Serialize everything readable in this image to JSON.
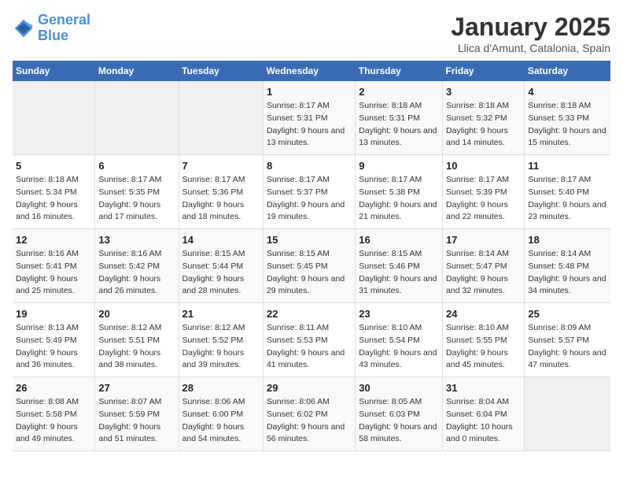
{
  "logo": {
    "line1": "General",
    "line2": "Blue"
  },
  "title": "January 2025",
  "subtitle": "Llica d'Amunt, Catalonia, Spain",
  "days_of_week": [
    "Sunday",
    "Monday",
    "Tuesday",
    "Wednesday",
    "Thursday",
    "Friday",
    "Saturday"
  ],
  "weeks": [
    [
      {
        "num": "",
        "info": ""
      },
      {
        "num": "",
        "info": ""
      },
      {
        "num": "",
        "info": ""
      },
      {
        "num": "1",
        "info": "Sunrise: 8:17 AM\nSunset: 5:31 PM\nDaylight: 9 hours and 13 minutes."
      },
      {
        "num": "2",
        "info": "Sunrise: 8:18 AM\nSunset: 5:31 PM\nDaylight: 9 hours and 13 minutes."
      },
      {
        "num": "3",
        "info": "Sunrise: 8:18 AM\nSunset: 5:32 PM\nDaylight: 9 hours and 14 minutes."
      },
      {
        "num": "4",
        "info": "Sunrise: 8:18 AM\nSunset: 5:33 PM\nDaylight: 9 hours and 15 minutes."
      }
    ],
    [
      {
        "num": "5",
        "info": "Sunrise: 8:18 AM\nSunset: 5:34 PM\nDaylight: 9 hours and 16 minutes."
      },
      {
        "num": "6",
        "info": "Sunrise: 8:17 AM\nSunset: 5:35 PM\nDaylight: 9 hours and 17 minutes."
      },
      {
        "num": "7",
        "info": "Sunrise: 8:17 AM\nSunset: 5:36 PM\nDaylight: 9 hours and 18 minutes."
      },
      {
        "num": "8",
        "info": "Sunrise: 8:17 AM\nSunset: 5:37 PM\nDaylight: 9 hours and 19 minutes."
      },
      {
        "num": "9",
        "info": "Sunrise: 8:17 AM\nSunset: 5:38 PM\nDaylight: 9 hours and 21 minutes."
      },
      {
        "num": "10",
        "info": "Sunrise: 8:17 AM\nSunset: 5:39 PM\nDaylight: 9 hours and 22 minutes."
      },
      {
        "num": "11",
        "info": "Sunrise: 8:17 AM\nSunset: 5:40 PM\nDaylight: 9 hours and 23 minutes."
      }
    ],
    [
      {
        "num": "12",
        "info": "Sunrise: 8:16 AM\nSunset: 5:41 PM\nDaylight: 9 hours and 25 minutes."
      },
      {
        "num": "13",
        "info": "Sunrise: 8:16 AM\nSunset: 5:42 PM\nDaylight: 9 hours and 26 minutes."
      },
      {
        "num": "14",
        "info": "Sunrise: 8:15 AM\nSunset: 5:44 PM\nDaylight: 9 hours and 28 minutes."
      },
      {
        "num": "15",
        "info": "Sunrise: 8:15 AM\nSunset: 5:45 PM\nDaylight: 9 hours and 29 minutes."
      },
      {
        "num": "16",
        "info": "Sunrise: 8:15 AM\nSunset: 5:46 PM\nDaylight: 9 hours and 31 minutes."
      },
      {
        "num": "17",
        "info": "Sunrise: 8:14 AM\nSunset: 5:47 PM\nDaylight: 9 hours and 32 minutes."
      },
      {
        "num": "18",
        "info": "Sunrise: 8:14 AM\nSunset: 5:48 PM\nDaylight: 9 hours and 34 minutes."
      }
    ],
    [
      {
        "num": "19",
        "info": "Sunrise: 8:13 AM\nSunset: 5:49 PM\nDaylight: 9 hours and 36 minutes."
      },
      {
        "num": "20",
        "info": "Sunrise: 8:12 AM\nSunset: 5:51 PM\nDaylight: 9 hours and 38 minutes."
      },
      {
        "num": "21",
        "info": "Sunrise: 8:12 AM\nSunset: 5:52 PM\nDaylight: 9 hours and 39 minutes."
      },
      {
        "num": "22",
        "info": "Sunrise: 8:11 AM\nSunset: 5:53 PM\nDaylight: 9 hours and 41 minutes."
      },
      {
        "num": "23",
        "info": "Sunrise: 8:10 AM\nSunset: 5:54 PM\nDaylight: 9 hours and 43 minutes."
      },
      {
        "num": "24",
        "info": "Sunrise: 8:10 AM\nSunset: 5:55 PM\nDaylight: 9 hours and 45 minutes."
      },
      {
        "num": "25",
        "info": "Sunrise: 8:09 AM\nSunset: 5:57 PM\nDaylight: 9 hours and 47 minutes."
      }
    ],
    [
      {
        "num": "26",
        "info": "Sunrise: 8:08 AM\nSunset: 5:58 PM\nDaylight: 9 hours and 49 minutes."
      },
      {
        "num": "27",
        "info": "Sunrise: 8:07 AM\nSunset: 5:59 PM\nDaylight: 9 hours and 51 minutes."
      },
      {
        "num": "28",
        "info": "Sunrise: 8:06 AM\nSunset: 6:00 PM\nDaylight: 9 hours and 54 minutes."
      },
      {
        "num": "29",
        "info": "Sunrise: 8:06 AM\nSunset: 6:02 PM\nDaylight: 9 hours and 56 minutes."
      },
      {
        "num": "30",
        "info": "Sunrise: 8:05 AM\nSunset: 6:03 PM\nDaylight: 9 hours and 58 minutes."
      },
      {
        "num": "31",
        "info": "Sunrise: 8:04 AM\nSunset: 6:04 PM\nDaylight: 10 hours and 0 minutes."
      },
      {
        "num": "",
        "info": ""
      }
    ]
  ]
}
